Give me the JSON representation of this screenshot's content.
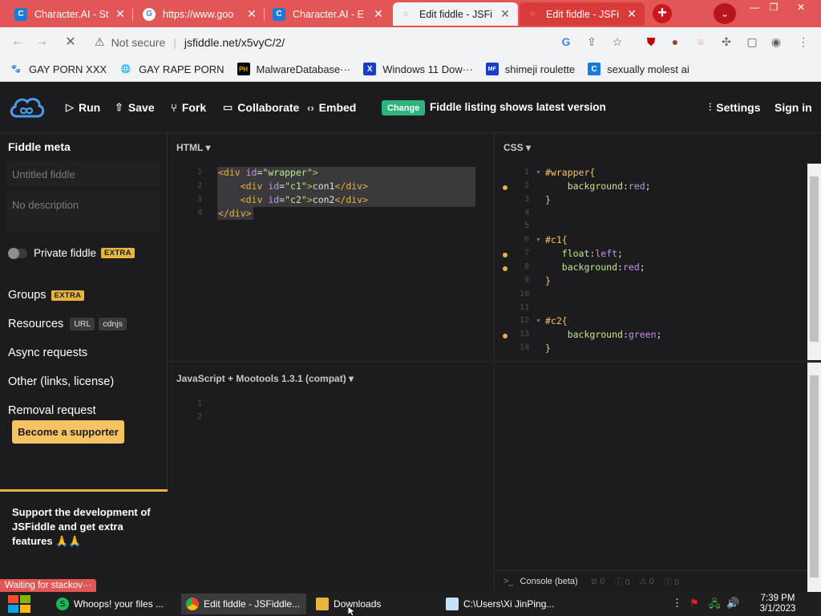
{
  "browser": {
    "tabs": [
      {
        "title": "Character.AI - St",
        "favicon": "C",
        "state": "inactive"
      },
      {
        "title": "https://www.goo",
        "favicon": "G",
        "state": "inactive"
      },
      {
        "title": "Character.AI - E",
        "favicon": "C",
        "state": "inactive"
      },
      {
        "title": "Edit fiddle - JSFi",
        "favicon": "",
        "state": "active"
      },
      {
        "title": "Edit fiddle - JSFi",
        "favicon": "",
        "state": "inactive"
      }
    ],
    "new_tab_symbol": "+",
    "tab_menu_symbol": "⌄",
    "window_controls": {
      "minimize": "—",
      "restore": "❐",
      "close": "✕"
    },
    "address": {
      "security_label": "Not secure",
      "url": "jsfiddle.net/x5vyC/2/"
    },
    "bookmarks": [
      {
        "label": "GAY PORN XXX",
        "icon": "paw-icon",
        "color": "#333333"
      },
      {
        "label": "GAY RAPE PORN",
        "icon": "globe-icon",
        "color": "#333333"
      },
      {
        "label": "MalwareDatabase···",
        "icon": "PH",
        "color": "#f7a600"
      },
      {
        "label": "Windows 11 Dow···",
        "icon": "X",
        "color": "#1a3cc9"
      },
      {
        "label": "shimeji roulette",
        "icon": "MF",
        "color": "#1a3cc9"
      },
      {
        "label": "sexually molest ai",
        "icon": "C",
        "color": "#1a7ad9"
      }
    ]
  },
  "header": {
    "run": "Run",
    "save": "Save",
    "fork": "Fork",
    "collaborate": "Collaborate",
    "embed": "Embed",
    "change_badge": "Change",
    "listing_text": "Fiddle listing shows latest version",
    "settings": "Settings",
    "sign_in": "Sign in"
  },
  "sidebar": {
    "title": "Fiddle meta",
    "title_placeholder": "Untitled fiddle",
    "description_placeholder": "No description",
    "private_label": "Private fiddle",
    "extra_badge": "EXTRA",
    "groups": "Groups",
    "resources": "Resources",
    "url_badge": "URL",
    "cdnjs_badge": "cdnjs",
    "async": "Async requests",
    "other": "Other (links, license)",
    "removal": "Removal request",
    "support_text": "Support the development of JSFiddle and get extra features 🙏🙏",
    "support_button": "Become a supporter"
  },
  "panels": {
    "html_label": "HTML ▾",
    "css_label": "CSS ▾",
    "js_label": "JavaScript + Mootools 1.3.1 (compat) ▾",
    "console_label": "Console (beta)",
    "console_stats": [
      "⊘ 0",
      "ⓘ 0",
      "⚠ 0",
      "ⓘ 0"
    ]
  },
  "html_code": [
    {
      "n": "1",
      "parts": [
        [
          "t-tag",
          "<div "
        ],
        [
          "t-attr",
          "id"
        ],
        [
          "t-plain",
          "="
        ],
        [
          "t-str",
          "\"wrapper\""
        ],
        [
          "t-tag",
          ">"
        ]
      ]
    },
    {
      "n": "2",
      "parts": [
        [
          "t-plain",
          "    "
        ],
        [
          "t-tag",
          "<div "
        ],
        [
          "t-attr",
          "id"
        ],
        [
          "t-plain",
          "="
        ],
        [
          "t-str",
          "\"c1\""
        ],
        [
          "t-tag",
          ">"
        ],
        [
          "t-plain",
          "con1"
        ],
        [
          "t-tag",
          "</div>"
        ]
      ]
    },
    {
      "n": "3",
      "parts": [
        [
          "t-plain",
          "    "
        ],
        [
          "t-tag",
          "<div "
        ],
        [
          "t-attr",
          "id"
        ],
        [
          "t-plain",
          "="
        ],
        [
          "t-str",
          "\"c2\""
        ],
        [
          "t-tag",
          ">"
        ],
        [
          "t-plain",
          "con2"
        ],
        [
          "t-tag",
          "</div>"
        ]
      ]
    },
    {
      "n": "4",
      "parts": [
        [
          "t-tag",
          "</div>"
        ]
      ]
    }
  ],
  "css_code": [
    {
      "n": "1",
      "parts": [
        [
          "t-sel",
          "#wrapper{"
        ]
      ]
    },
    {
      "n": "2",
      "parts": [
        [
          "t-plain",
          "    "
        ],
        [
          "t-prop",
          "background"
        ],
        [
          "t-plain",
          ":"
        ],
        [
          "t-val",
          "red"
        ],
        [
          "t-plain",
          ";"
        ]
      ]
    },
    {
      "n": "3",
      "parts": [
        [
          "t-sel",
          "}"
        ]
      ]
    },
    {
      "n": "4",
      "parts": []
    },
    {
      "n": "5",
      "parts": []
    },
    {
      "n": "6",
      "parts": [
        [
          "t-sel",
          "#c1{"
        ]
      ]
    },
    {
      "n": "7",
      "parts": [
        [
          "t-plain",
          "   "
        ],
        [
          "t-prop",
          "float"
        ],
        [
          "t-plain",
          ":"
        ],
        [
          "t-val",
          "left"
        ],
        [
          "t-plain",
          ";"
        ]
      ]
    },
    {
      "n": "8",
      "parts": [
        [
          "t-plain",
          "   "
        ],
        [
          "t-prop",
          "background"
        ],
        [
          "t-plain",
          ":"
        ],
        [
          "t-val",
          "red"
        ],
        [
          "t-plain",
          ";"
        ]
      ]
    },
    {
      "n": "9",
      "parts": [
        [
          "t-sel",
          "}"
        ]
      ]
    },
    {
      "n": "10",
      "parts": []
    },
    {
      "n": "11",
      "parts": []
    },
    {
      "n": "12",
      "parts": [
        [
          "t-sel",
          "#c2{"
        ]
      ]
    },
    {
      "n": "13",
      "parts": [
        [
          "t-plain",
          "    "
        ],
        [
          "t-prop",
          "background"
        ],
        [
          "t-plain",
          ":"
        ],
        [
          "t-val",
          "green"
        ],
        [
          "t-plain",
          ";"
        ]
      ]
    },
    {
      "n": "14",
      "parts": [
        [
          "t-sel",
          "}"
        ]
      ]
    }
  ],
  "js_code": [
    {
      "n": "1"
    },
    {
      "n": "2"
    }
  ],
  "status_popup": "Waiting for stackov···",
  "taskbar": {
    "items": [
      {
        "label": "Whoops! your files ...",
        "icon": "S",
        "color": "#1db954"
      },
      {
        "label": "Edit fiddle - JSFiddle...",
        "icon": "chrome",
        "color": "#e25656"
      },
      {
        "label": "Downloads",
        "icon": "folder",
        "color": "#e8b33f"
      },
      {
        "label": "C:\\Users\\Xi JinPing...",
        "icon": "notepad",
        "color": "#c8e0ff"
      }
    ],
    "time": "7:39 PM",
    "date": "3/1/2023"
  }
}
